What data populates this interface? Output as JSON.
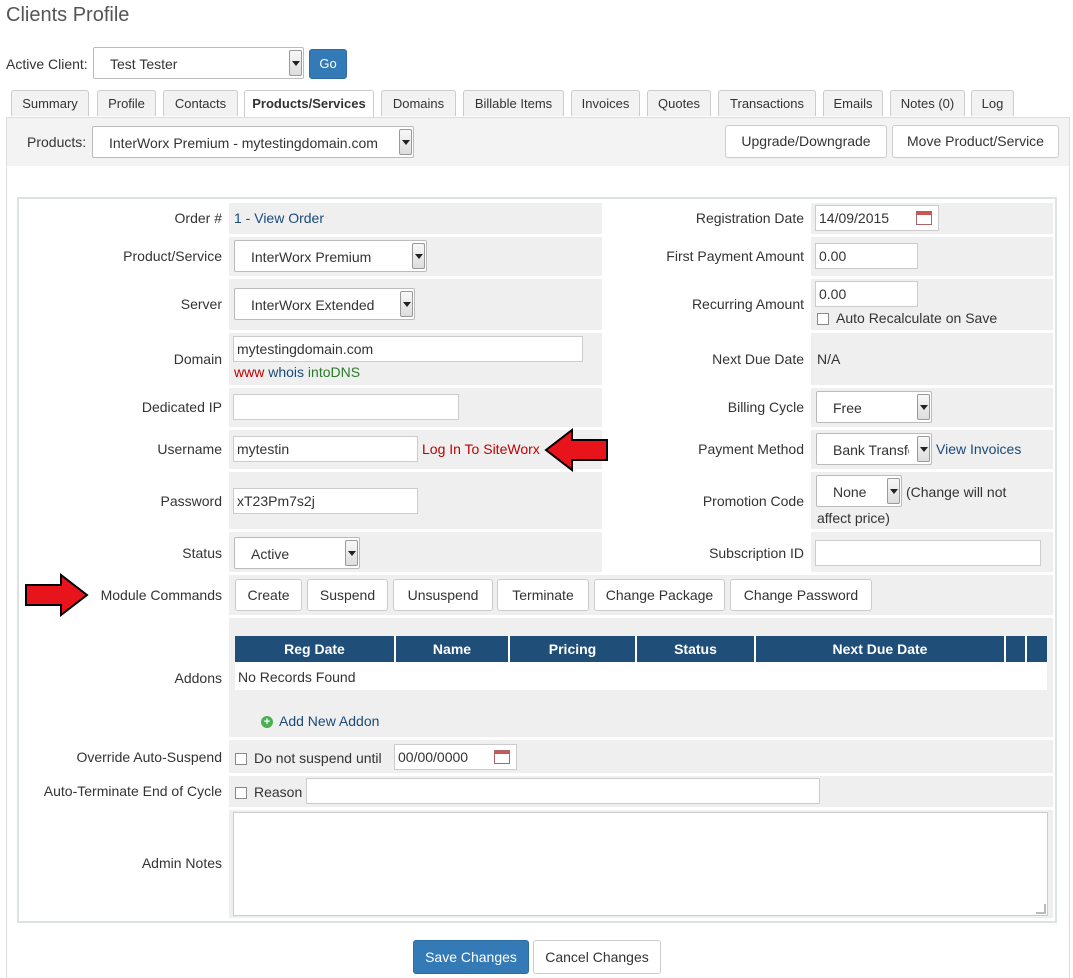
{
  "page": {
    "title": "Clients Profile"
  },
  "client_select": {
    "label": "Active Client:",
    "value": "Test Tester",
    "go": "Go"
  },
  "tabs": [
    "Summary",
    "Profile",
    "Contacts",
    "Products/Services",
    "Domains",
    "Billable Items",
    "Invoices",
    "Quotes",
    "Transactions",
    "Emails",
    "Notes (0)",
    "Log"
  ],
  "products_bar": {
    "label": "Products:",
    "value": "InterWorx Premium - mytestingdomain.com",
    "upgrade": "Upgrade/Downgrade",
    "move": "Move Product/Service"
  },
  "left": {
    "order_label": "Order #",
    "order_value": "1 - View Order",
    "product_label": "Product/Service",
    "product_value": "InterWorx Premium",
    "server_label": "Server",
    "server_value": "InterWorx Extended",
    "domain_label": "Domain",
    "domain_value": "mytestingdomain.com",
    "domain_link_www": "www",
    "domain_link_whois": "whois",
    "domain_link_intodns": "intoDNS",
    "ip_label": "Dedicated IP",
    "ip_value": "",
    "username_label": "Username",
    "username_value": "mytestin",
    "login_link": "Log In To SiteWorx",
    "password_label": "Password",
    "password_value": "xT23Pm7s2j",
    "status_label": "Status",
    "status_value": "Active"
  },
  "right": {
    "reg_label": "Registration Date",
    "reg_value": "14/09/2015",
    "first_label": "First Payment Amount",
    "first_value": "0.00",
    "recurring_label": "Recurring Amount",
    "recurring_value": "0.00",
    "auto_recalc": "Auto Recalculate on Save",
    "next_due_label": "Next Due Date",
    "next_due_value": "N/A",
    "billing_label": "Billing Cycle",
    "billing_value": "Free",
    "payment_label": "Payment Method",
    "payment_value": "Bank Transfer",
    "view_invoices": "View Invoices",
    "promo_label": "Promotion Code",
    "promo_value": "None",
    "promo_note_1": "(Change will not",
    "promo_note_2": "affect price)",
    "sub_label": "Subscription ID",
    "sub_value": ""
  },
  "module": {
    "label": "Module Commands",
    "buttons": [
      "Create",
      "Suspend",
      "Unsuspend",
      "Terminate",
      "Change Package",
      "Change Password"
    ]
  },
  "addons": {
    "label": "Addons",
    "headers": [
      "Reg Date",
      "Name",
      "Pricing",
      "Status",
      "Next Due Date"
    ],
    "empty": "No Records Found",
    "add": "Add New Addon"
  },
  "override": {
    "label": "Override Auto-Suspend",
    "checkbox_label": "Do not suspend until",
    "date": "00/00/0000"
  },
  "autoterm": {
    "label": "Auto-Terminate End of Cycle",
    "checkbox_label": "Reason",
    "reason": ""
  },
  "notes": {
    "label": "Admin Notes",
    "value": ""
  },
  "footer": {
    "save": "Save Changes",
    "cancel": "Cancel Changes"
  },
  "colors": {
    "primary": "#337ab7",
    "header": "#1f4e79",
    "cell_bg": "#efefef",
    "arrow": "#e8141b"
  }
}
